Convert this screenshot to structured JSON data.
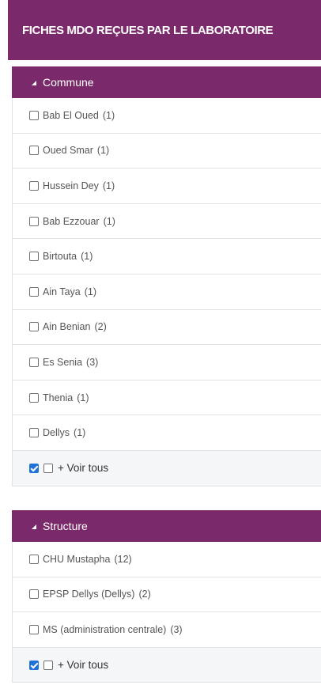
{
  "header": {
    "title": "FICHES MDO REÇUES PAR LE LABORATOIRE"
  },
  "commune": {
    "title": "Commune",
    "items": [
      {
        "label": "Bab El Oued",
        "count": "(1)"
      },
      {
        "label": "Oued Smar",
        "count": "(1)"
      },
      {
        "label": "Hussein Dey",
        "count": "(1)"
      },
      {
        "label": "Bab Ezzouar",
        "count": "(1)"
      },
      {
        "label": "Birtouta",
        "count": "(1)"
      },
      {
        "label": "Ain Taya",
        "count": "(1)"
      },
      {
        "label": "Ain Benian",
        "count": "(2)"
      },
      {
        "label": "Es Senia",
        "count": "(3)"
      },
      {
        "label": "Thenia",
        "count": "(1)"
      },
      {
        "label": "Dellys",
        "count": "(1)"
      }
    ],
    "voir_tous": "+ Voir tous"
  },
  "structure": {
    "title": "Structure",
    "items": [
      {
        "label": "CHU Mustapha",
        "count": "(12)"
      },
      {
        "label": "EPSP Dellys (Dellys)",
        "count": "(2)"
      },
      {
        "label": "MS (administration centrale)",
        "count": "(3)"
      }
    ],
    "voir_tous": "+ Voir tous"
  },
  "colors": {
    "accent": "#7a2a6a",
    "checkbox_checked": "#1f73d8"
  }
}
